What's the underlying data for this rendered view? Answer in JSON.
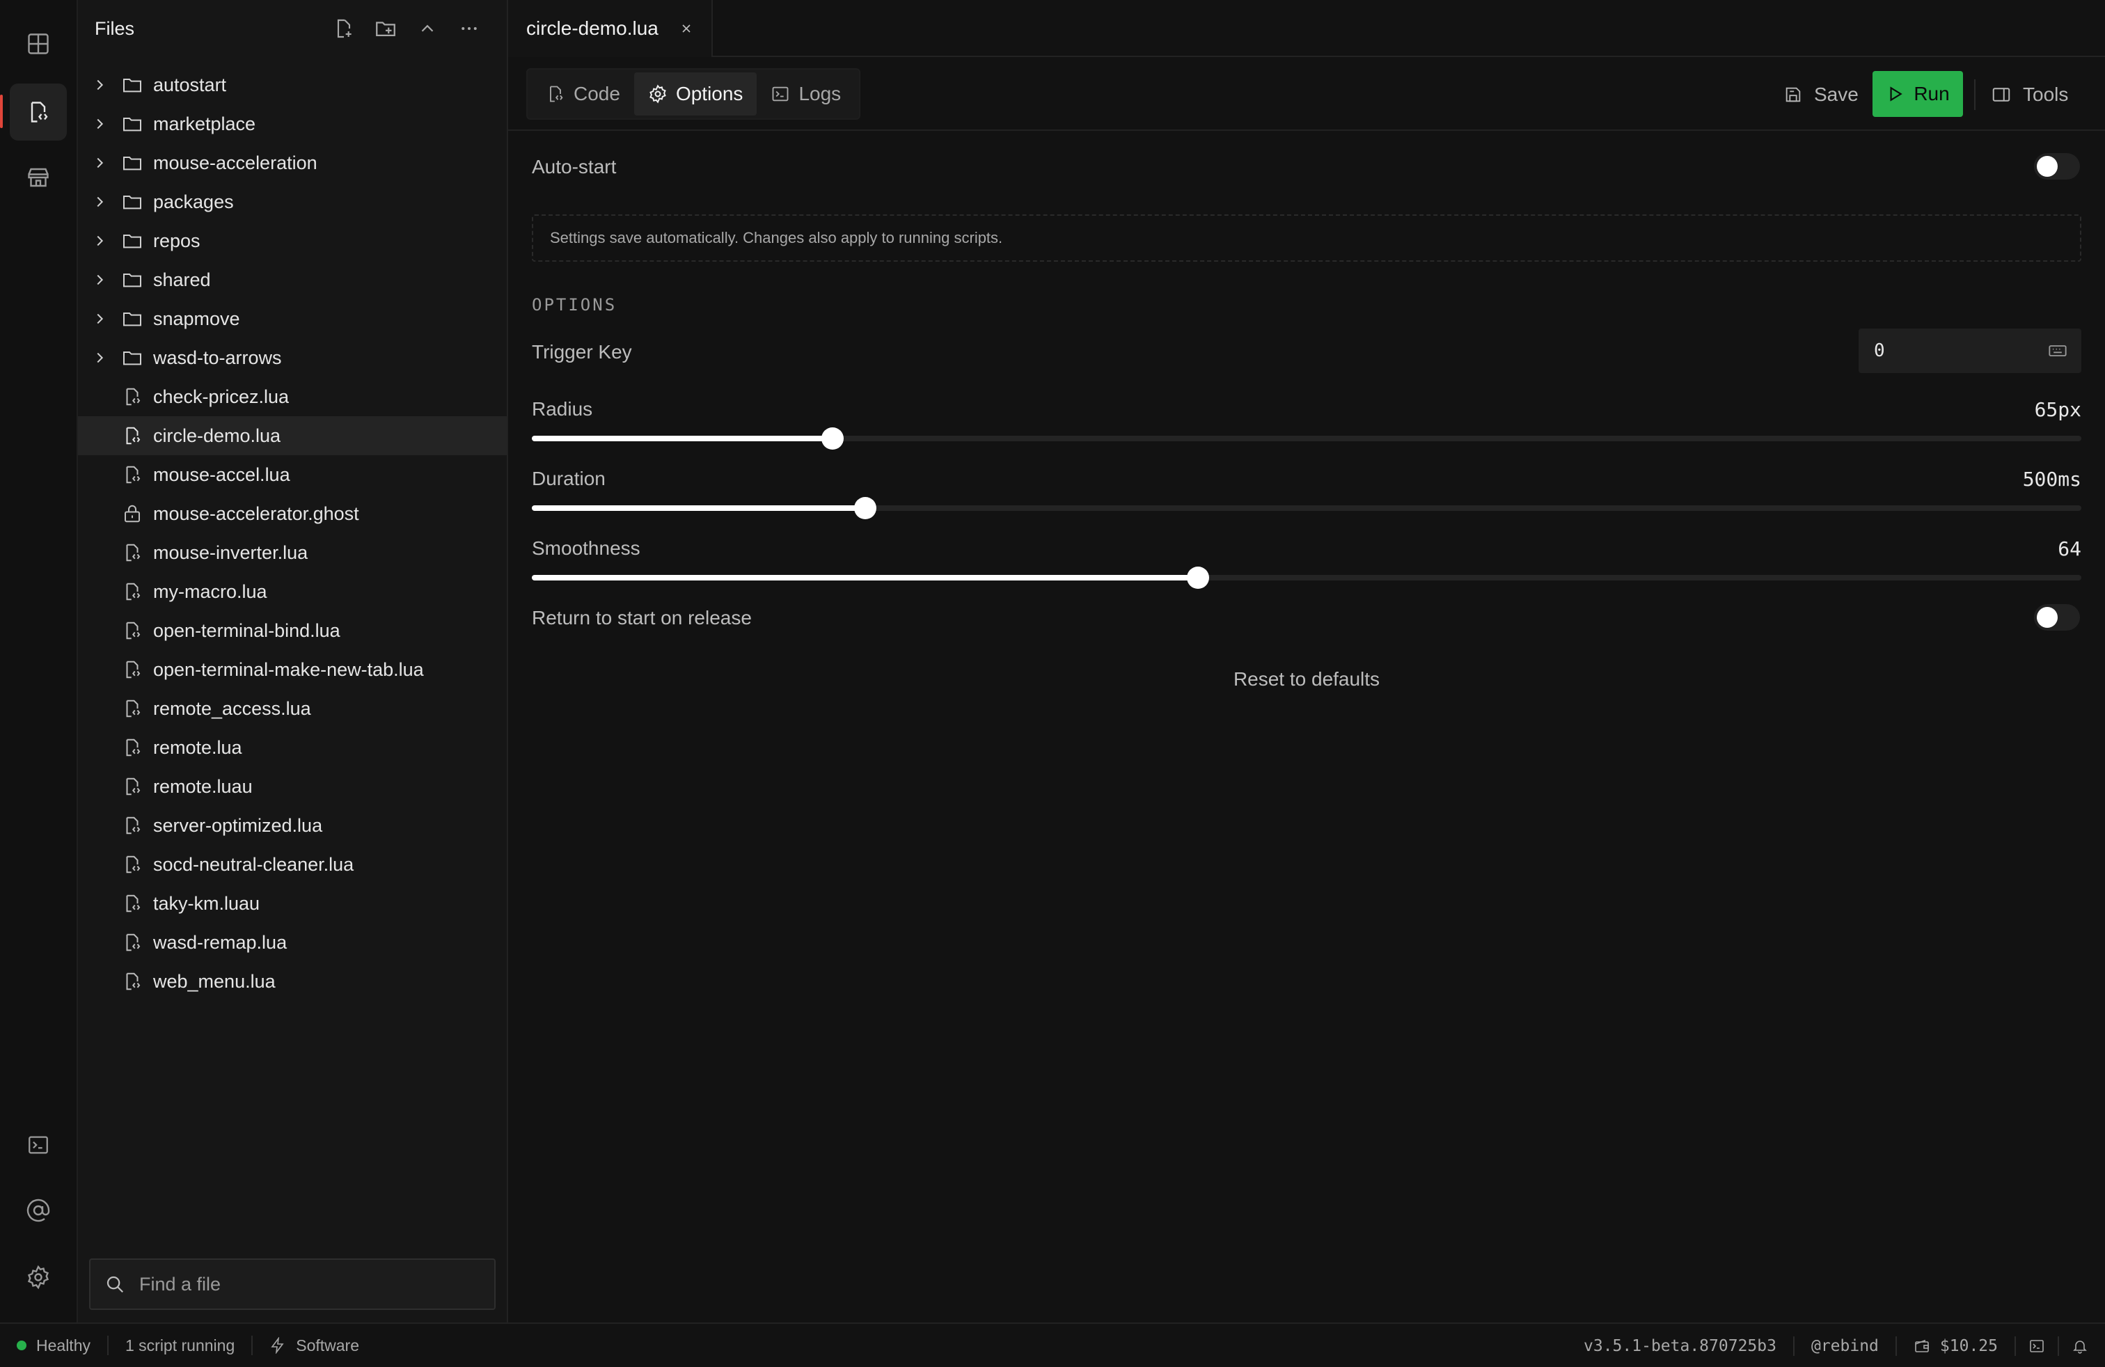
{
  "activity_bar": {
    "items": [
      {
        "name": "dashboard",
        "icon": "grid-icon"
      },
      {
        "name": "scripts",
        "icon": "script-file-icon",
        "active": true
      },
      {
        "name": "marketplace",
        "icon": "store-icon"
      }
    ],
    "bottom_items": [
      {
        "name": "terminal",
        "icon": "terminal-icon"
      },
      {
        "name": "account",
        "icon": "at-sign-icon"
      },
      {
        "name": "settings",
        "icon": "gear-icon"
      }
    ]
  },
  "files": {
    "title": "Files",
    "folders": [
      "autostart",
      "marketplace",
      "mouse-acceleration",
      "packages",
      "repos",
      "shared",
      "snapmove",
      "wasd-to-arrows"
    ],
    "items": [
      {
        "name": "check-pricez.lua",
        "type": "script"
      },
      {
        "name": "circle-demo.lua",
        "type": "script",
        "selected": true
      },
      {
        "name": "mouse-accel.lua",
        "type": "script"
      },
      {
        "name": "mouse-accelerator.ghost",
        "type": "locked"
      },
      {
        "name": "mouse-inverter.lua",
        "type": "script"
      },
      {
        "name": "my-macro.lua",
        "type": "script"
      },
      {
        "name": "open-terminal-bind.lua",
        "type": "script"
      },
      {
        "name": "open-terminal-make-new-tab.lua",
        "type": "script"
      },
      {
        "name": "remote_access.lua",
        "type": "script"
      },
      {
        "name": "remote.lua",
        "type": "script"
      },
      {
        "name": "remote.luau",
        "type": "script"
      },
      {
        "name": "server-optimized.lua",
        "type": "script"
      },
      {
        "name": "socd-neutral-cleaner.lua",
        "type": "script"
      },
      {
        "name": "taky-km.luau",
        "type": "script"
      },
      {
        "name": "wasd-remap.lua",
        "type": "script"
      },
      {
        "name": "web_menu.lua",
        "type": "script"
      }
    ],
    "search_placeholder": "Find a file"
  },
  "editor": {
    "open_tab": "circle-demo.lua",
    "view_tabs": [
      "Code",
      "Options",
      "Logs"
    ],
    "active_view": "Options",
    "save_label": "Save",
    "run_label": "Run",
    "tools_label": "Tools",
    "run_color": "#27b04b"
  },
  "options": {
    "auto_start_label": "Auto-start",
    "auto_start": false,
    "info_text": "Settings save automatically. Changes also apply to running scripts.",
    "section_heading": "OPTIONS",
    "trigger_key_label": "Trigger Key",
    "trigger_key_value": "0",
    "sliders": [
      {
        "label": "Radius",
        "display": "65px",
        "fraction": 0.194
      },
      {
        "label": "Duration",
        "display": "500ms",
        "fraction": 0.215
      },
      {
        "label": "Smoothness",
        "display": "64",
        "fraction": 0.43
      }
    ],
    "return_label": "Return to start on release",
    "return_to_start": false,
    "reset_label": "Reset to defaults"
  },
  "status_bar": {
    "health": "Healthy",
    "health_color": "#27b04b",
    "scripts_running": "1 script running",
    "mode": "Software",
    "version": "v3.5.1-beta.870725b3",
    "user": "@rebind",
    "balance": "$10.25"
  }
}
